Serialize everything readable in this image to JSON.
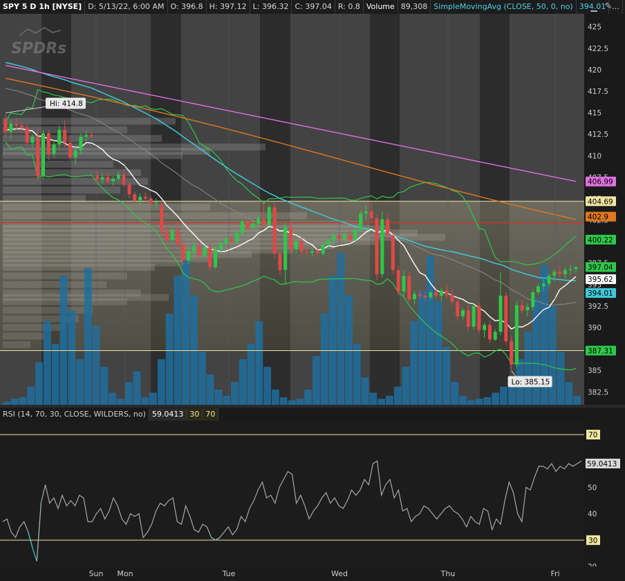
{
  "header": {
    "symbol": "SPY 5 D 1h [NYSE]",
    "date": "D: 5/13/22, 6:00 AM",
    "open": "O: 396.8",
    "high": "H: 397.12",
    "low": "L: 396.32",
    "close": "C: 397.04",
    "range": "R: 0.8",
    "volume_label": "Volume",
    "volume_value": "89,308",
    "sma_label": "SimpleMovingAvg (CLOSE, 50, 0, no)",
    "sma_value": "394.01",
    "more": "..."
  },
  "watermark": "SPDRs",
  "rsi_header": {
    "label": "RSI (14, 70, 30, CLOSE, WILDERS, no)",
    "value": "59.0413",
    "ob": "30",
    "os": "70"
  },
  "chart_data": [
    {
      "type": "candlestick",
      "ylim": [
        381,
        426.5
      ],
      "yticks": [
        "425",
        "422.5",
        "420",
        "417.5",
        "415",
        "412.5",
        "410",
        "407.5",
        "405",
        "402.5",
        "400",
        "397.5",
        "395",
        "392.5",
        "390",
        "387.5",
        "385",
        "382.5"
      ],
      "xticks": [
        "Sun",
        "Mon",
        "Tue",
        "Wed",
        "Thu",
        "Fri"
      ],
      "annotations": [
        "Hi: 414.8",
        "Lo: 385.15"
      ],
      "price_labels": [
        {
          "text": "406.99",
          "value": 406.99,
          "color": "#e070e0"
        },
        {
          "text": "404.69",
          "value": 404.69,
          "color": "#f0e6a0"
        },
        {
          "text": "402.9",
          "value": 402.9,
          "color": "#e0781e"
        },
        {
          "text": "400.22",
          "value": 400.22,
          "color": "#2ec84a"
        },
        {
          "text": "397.04",
          "value": 397.04,
          "color": "#2ec84a"
        },
        {
          "text": "395.62",
          "value": 395.62,
          "color": "#ffffff"
        },
        {
          "text": "394.01",
          "value": 394.01,
          "color": "#3fc8d8"
        },
        {
          "text": "387.31",
          "value": 387.31,
          "color": "#2ec84a"
        }
      ],
      "horizontal_lines": [
        404.69,
        387.31,
        402.2
      ],
      "candles": [
        {
          "o": 414.2,
          "h": 414.8,
          "l": 412.1,
          "c": 412.8
        },
        {
          "o": 412.8,
          "h": 414.1,
          "l": 412.0,
          "c": 413.7
        },
        {
          "o": 413.7,
          "h": 414.4,
          "l": 413.0,
          "c": 413.5
        },
        {
          "o": 413.5,
          "h": 413.9,
          "l": 412.7,
          "c": 413.2
        },
        {
          "o": 413.2,
          "h": 413.6,
          "l": 411.2,
          "c": 411.5
        },
        {
          "o": 411.5,
          "h": 412.5,
          "l": 410.9,
          "c": 412.2
        },
        {
          "o": 412.2,
          "h": 413.1,
          "l": 407.2,
          "c": 407.6
        },
        {
          "o": 407.6,
          "h": 413.0,
          "l": 407.3,
          "c": 412.6
        },
        {
          "o": 412.6,
          "h": 413.0,
          "l": 409.5,
          "c": 410.2
        },
        {
          "o": 410.2,
          "h": 411.8,
          "l": 409.8,
          "c": 411.3
        },
        {
          "o": 411.3,
          "h": 413.5,
          "l": 410.8,
          "c": 413.0
        },
        {
          "o": 413.0,
          "h": 414.1,
          "l": 411.0,
          "c": 411.5
        },
        {
          "o": 411.5,
          "h": 412.4,
          "l": 409.4,
          "c": 409.8
        },
        {
          "o": 409.8,
          "h": 411.0,
          "l": 408.9,
          "c": 410.6
        },
        {
          "o": 410.6,
          "h": 412.6,
          "l": 410.2,
          "c": 412.2
        },
        {
          "o": 412.2,
          "h": 412.9,
          "l": 411.7,
          "c": 412.4
        },
        {
          "o": 412.4,
          "h": 412.7,
          "l": 412.1,
          "c": 412.2
        },
        {
          "o": 407.7,
          "h": 408.2,
          "l": 406.8,
          "c": 407.2
        },
        {
          "o": 407.2,
          "h": 407.9,
          "l": 406.7,
          "c": 407.5
        },
        {
          "o": 407.5,
          "h": 408.0,
          "l": 406.8,
          "c": 407.0
        },
        {
          "o": 407.0,
          "h": 407.6,
          "l": 406.5,
          "c": 407.3
        },
        {
          "o": 407.3,
          "h": 408.1,
          "l": 407.0,
          "c": 407.8
        },
        {
          "o": 407.8,
          "h": 408.4,
          "l": 406.4,
          "c": 406.6
        },
        {
          "o": 406.6,
          "h": 406.9,
          "l": 405.0,
          "c": 405.5
        },
        {
          "o": 405.5,
          "h": 405.8,
          "l": 404.3,
          "c": 404.8
        },
        {
          "o": 404.8,
          "h": 405.6,
          "l": 404.2,
          "c": 405.2
        },
        {
          "o": 405.2,
          "h": 405.7,
          "l": 404.6,
          "c": 405.0
        },
        {
          "o": 405.0,
          "h": 405.3,
          "l": 404.2,
          "c": 404.5
        },
        {
          "o": 404.5,
          "h": 405.0,
          "l": 403.8,
          "c": 404.6
        },
        {
          "o": 404.2,
          "h": 404.8,
          "l": 400.6,
          "c": 401.2
        },
        {
          "o": 401.2,
          "h": 402.0,
          "l": 399.6,
          "c": 400.2
        },
        {
          "o": 400.2,
          "h": 401.6,
          "l": 399.8,
          "c": 401.3
        },
        {
          "o": 401.3,
          "h": 402.2,
          "l": 399.2,
          "c": 399.7
        },
        {
          "o": 399.7,
          "h": 400.4,
          "l": 397.3,
          "c": 397.8
        },
        {
          "o": 397.8,
          "h": 399.3,
          "l": 397.4,
          "c": 398.9
        },
        {
          "o": 398.9,
          "h": 400.0,
          "l": 398.2,
          "c": 399.5
        },
        {
          "o": 399.5,
          "h": 400.1,
          "l": 398.0,
          "c": 398.4
        },
        {
          "o": 398.4,
          "h": 399.6,
          "l": 398.0,
          "c": 399.3
        },
        {
          "o": 399.3,
          "h": 399.8,
          "l": 396.6,
          "c": 397.0
        },
        {
          "o": 397.0,
          "h": 399.5,
          "l": 396.8,
          "c": 399.1
        },
        {
          "o": 399.1,
          "h": 400.0,
          "l": 398.7,
          "c": 399.8
        },
        {
          "o": 399.8,
          "h": 400.6,
          "l": 399.4,
          "c": 400.3
        },
        {
          "o": 400.3,
          "h": 400.7,
          "l": 399.7,
          "c": 400.0
        },
        {
          "o": 400.0,
          "h": 401.3,
          "l": 399.8,
          "c": 401.0
        },
        {
          "o": 401.0,
          "h": 402.6,
          "l": 400.7,
          "c": 402.3
        },
        {
          "o": 402.3,
          "h": 402.8,
          "l": 401.2,
          "c": 401.6
        },
        {
          "o": 401.6,
          "h": 402.5,
          "l": 401.3,
          "c": 402.1
        },
        {
          "o": 402.1,
          "h": 403.0,
          "l": 401.6,
          "c": 402.7
        },
        {
          "o": 402.7,
          "h": 404.8,
          "l": 401.5,
          "c": 401.9
        },
        {
          "o": 401.9,
          "h": 404.3,
          "l": 401.8,
          "c": 404.0
        },
        {
          "o": 404.0,
          "h": 404.6,
          "l": 398.1,
          "c": 398.6
        },
        {
          "o": 398.6,
          "h": 399.6,
          "l": 396.1,
          "c": 396.7
        },
        {
          "o": 396.7,
          "h": 402.2,
          "l": 395.0,
          "c": 401.7
        },
        {
          "o": 401.7,
          "h": 402.4,
          "l": 398.7,
          "c": 399.1
        },
        {
          "o": 399.1,
          "h": 400.4,
          "l": 398.6,
          "c": 400.0
        },
        {
          "o": 400.0,
          "h": 400.6,
          "l": 398.3,
          "c": 398.8
        },
        {
          "o": 398.8,
          "h": 399.4,
          "l": 398.2,
          "c": 398.7
        },
        {
          "o": 398.7,
          "h": 399.1,
          "l": 398.3,
          "c": 398.9
        },
        {
          "o": 398.9,
          "h": 399.3,
          "l": 398.4,
          "c": 398.6
        },
        {
          "o": 398.6,
          "h": 399.9,
          "l": 398.4,
          "c": 399.6
        },
        {
          "o": 399.6,
          "h": 400.4,
          "l": 399.3,
          "c": 400.1
        },
        {
          "o": 400.1,
          "h": 401.0,
          "l": 399.8,
          "c": 400.7
        },
        {
          "o": 400.7,
          "h": 401.0,
          "l": 399.9,
          "c": 400.3
        },
        {
          "o": 400.3,
          "h": 401.2,
          "l": 400.0,
          "c": 400.8
        },
        {
          "o": 400.8,
          "h": 401.3,
          "l": 399.8,
          "c": 400.2
        },
        {
          "o": 400.2,
          "h": 401.6,
          "l": 399.9,
          "c": 401.4
        },
        {
          "o": 401.4,
          "h": 403.6,
          "l": 401.1,
          "c": 403.3
        },
        {
          "o": 403.3,
          "h": 404.2,
          "l": 402.6,
          "c": 403.5
        },
        {
          "o": 403.5,
          "h": 404.6,
          "l": 402.2,
          "c": 402.7
        },
        {
          "o": 402.7,
          "h": 403.2,
          "l": 395.5,
          "c": 396.2
        },
        {
          "o": 396.2,
          "h": 403.5,
          "l": 395.8,
          "c": 402.6
        },
        {
          "o": 402.6,
          "h": 403.3,
          "l": 400.1,
          "c": 400.7
        },
        {
          "o": 400.7,
          "h": 401.1,
          "l": 396.3,
          "c": 396.7
        },
        {
          "o": 396.7,
          "h": 397.2,
          "l": 393.7,
          "c": 394.2
        },
        {
          "o": 394.2,
          "h": 396.6,
          "l": 393.6,
          "c": 396.0
        },
        {
          "o": 396.0,
          "h": 396.4,
          "l": 392.9,
          "c": 393.3
        },
        {
          "o": 393.3,
          "h": 394.3,
          "l": 392.7,
          "c": 393.9
        },
        {
          "o": 393.9,
          "h": 394.4,
          "l": 393.3,
          "c": 393.7
        },
        {
          "o": 393.7,
          "h": 394.2,
          "l": 393.1,
          "c": 393.5
        },
        {
          "o": 393.5,
          "h": 394.4,
          "l": 393.2,
          "c": 394.1
        },
        {
          "o": 394.1,
          "h": 394.7,
          "l": 393.3,
          "c": 393.7
        },
        {
          "o": 393.7,
          "h": 394.6,
          "l": 393.0,
          "c": 394.3
        },
        {
          "o": 394.3,
          "h": 395.0,
          "l": 393.4,
          "c": 393.8
        },
        {
          "o": 393.8,
          "h": 394.4,
          "l": 392.6,
          "c": 393.0
        },
        {
          "o": 393.0,
          "h": 393.5,
          "l": 390.8,
          "c": 391.3
        },
        {
          "o": 391.3,
          "h": 392.3,
          "l": 390.9,
          "c": 392.0
        },
        {
          "o": 392.0,
          "h": 392.6,
          "l": 389.6,
          "c": 390.1
        },
        {
          "o": 390.1,
          "h": 392.8,
          "l": 389.8,
          "c": 392.5
        },
        {
          "o": 392.5,
          "h": 392.9,
          "l": 389.3,
          "c": 389.7
        },
        {
          "o": 389.7,
          "h": 390.6,
          "l": 388.8,
          "c": 390.3
        },
        {
          "o": 390.3,
          "h": 390.8,
          "l": 388.2,
          "c": 388.6
        },
        {
          "o": 388.6,
          "h": 389.8,
          "l": 388.4,
          "c": 389.5
        },
        {
          "o": 389.5,
          "h": 396.4,
          "l": 389.1,
          "c": 393.7
        },
        {
          "o": 393.7,
          "h": 394.1,
          "l": 388.0,
          "c": 388.4
        },
        {
          "o": 388.4,
          "h": 389.0,
          "l": 385.15,
          "c": 385.7
        },
        {
          "o": 385.7,
          "h": 393.1,
          "l": 385.4,
          "c": 392.6
        },
        {
          "o": 392.6,
          "h": 393.2,
          "l": 391.6,
          "c": 392.0
        },
        {
          "o": 392.0,
          "h": 392.8,
          "l": 391.3,
          "c": 392.4
        },
        {
          "o": 392.4,
          "h": 394.4,
          "l": 392.0,
          "c": 394.1
        },
        {
          "o": 394.1,
          "h": 395.1,
          "l": 393.8,
          "c": 394.8
        },
        {
          "o": 394.8,
          "h": 395.6,
          "l": 394.2,
          "c": 395.1
        },
        {
          "o": 395.1,
          "h": 396.3,
          "l": 394.7,
          "c": 396.0
        },
        {
          "o": 396.0,
          "h": 396.8,
          "l": 395.4,
          "c": 396.5
        },
        {
          "o": 396.5,
          "h": 397.2,
          "l": 395.9,
          "c": 396.2
        },
        {
          "o": 396.2,
          "h": 397.0,
          "l": 395.7,
          "c": 396.7
        },
        {
          "o": 396.7,
          "h": 397.3,
          "l": 396.1,
          "c": 396.8
        },
        {
          "o": 396.8,
          "h": 397.12,
          "l": 396.32,
          "c": 397.04
        }
      ],
      "volume_bars": [
        0.02,
        0.04,
        0.05,
        0.12,
        0.28,
        0.55,
        0.4,
        0.85,
        0.62,
        0.3,
        0.9,
        0.52,
        0.25,
        0.08,
        0.04,
        0.15,
        0.22,
        0.05,
        0.08,
        0.3,
        0.6,
        0.85,
        0.95,
        0.72,
        0.35,
        0.2,
        0.1,
        0.06,
        0.15,
        0.3,
        0.4,
        0.55,
        0.25,
        0.1,
        0.05,
        0.03,
        0.04,
        0.1,
        0.32,
        0.6,
        0.85,
        1.0,
        0.72,
        0.4,
        0.18,
        0.08,
        0.04,
        0.06,
        0.12,
        0.25,
        0.55,
        0.75,
        0.98,
        0.68,
        0.38,
        0.15,
        0.06,
        0.03,
        0.04,
        0.05,
        0.08,
        0.12,
        0.18,
        0.3,
        0.48,
        0.7,
        0.92,
        0.65,
        0.35,
        0.15,
        0.06
      ]
    },
    {
      "type": "line",
      "name": "RSI",
      "ylim": [
        20,
        75
      ],
      "yticks": [
        "70",
        "50",
        "40",
        "30",
        "20"
      ],
      "current_value": 59.0413,
      "overbought": 70,
      "oversold": 30,
      "values": [
        37,
        38,
        33,
        31,
        35,
        37,
        33,
        27,
        22,
        44,
        51,
        44,
        46,
        42,
        47,
        43,
        45,
        43,
        47,
        46,
        37,
        37,
        40,
        42,
        38,
        41,
        46,
        43,
        38,
        36,
        40,
        39,
        40,
        31,
        33,
        36,
        41,
        44,
        43,
        45,
        46,
        37,
        36,
        43,
        39,
        34,
        33,
        36,
        35,
        31,
        30,
        31,
        33,
        35,
        32,
        34,
        39,
        37,
        42,
        45,
        49,
        52,
        46,
        47,
        44,
        50,
        53,
        56,
        55,
        44,
        47,
        43,
        38,
        41,
        43,
        46,
        48,
        44,
        46,
        43,
        42,
        45,
        49,
        47,
        49,
        53,
        51,
        59,
        60,
        47,
        51,
        53,
        46,
        49,
        41,
        42,
        37,
        39,
        40,
        43,
        42,
        40,
        38,
        40,
        42,
        43,
        41,
        40,
        38,
        35,
        39,
        37,
        36,
        42,
        41,
        34,
        38,
        36,
        45,
        52,
        48,
        40,
        37,
        50,
        49,
        54,
        58,
        58,
        57,
        59,
        56,
        58,
        57,
        59,
        58,
        59,
        60
      ]
    }
  ]
}
